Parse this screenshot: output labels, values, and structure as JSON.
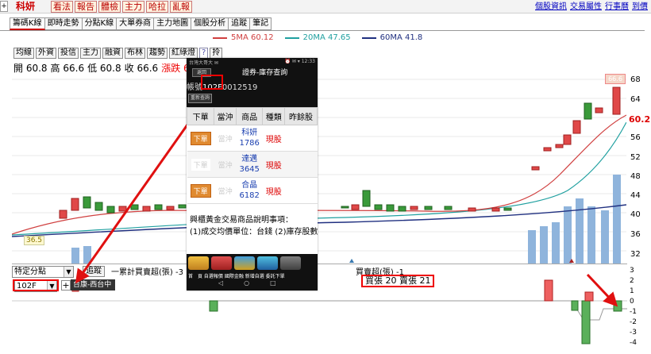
{
  "topbar": {
    "home_icon": "plus-icon",
    "stock_name": "科妍",
    "menu": [
      "看法",
      "報告",
      "體檢",
      "主力",
      "哈拉",
      "亂報"
    ],
    "links": [
      "個股資訊",
      "交易屬性",
      "行事曆",
      "到價"
    ]
  },
  "tabs": [
    "籌碼K線",
    "即時走勢",
    "分點K線",
    "大單券商",
    "主力地圖",
    "個股分析",
    "追蹤",
    "筆記"
  ],
  "legend": [
    {
      "label": "5MA 60.12",
      "color": "#d04040"
    },
    {
      "label": "20MA 47.65",
      "color": "#20a0a0"
    },
    {
      "label": "60MA 41.8",
      "color": "#203080"
    }
  ],
  "tools": [
    "均線",
    "外資",
    "投信",
    "主力",
    "融資",
    "布林",
    "趨勢",
    "紅綠燈",
    "?",
    "拎"
  ],
  "ohlc": {
    "open": "開 60.8",
    "high": "高 66.6",
    "low": "低 60.8",
    "close": "收 66.6",
    "change": "漲跌 6"
  },
  "main_axis": [
    "68",
    "64",
    "60",
    "56",
    "52",
    "48",
    "44",
    "40",
    "36",
    "32"
  ],
  "price_tag": "66.6",
  "min_tag": "36.5",
  "current_price": "60.2",
  "lower": {
    "mode_select": "特定分點",
    "track_button": "追蹤",
    "acc_label": "一累計買賣超(張) -3",
    "broker_select": "102F",
    "plus": "+",
    "broker_popup": "台康-西台中",
    "bs_label": "買賣超(張) -1",
    "bs_detail": "買張 20 賣張 21",
    "axis": [
      "3",
      "2",
      "1",
      "0",
      "-1",
      "-2",
      "-3",
      "-4"
    ]
  },
  "phone": {
    "status_left": "台灣大哥大 ✉",
    "status_right": "⏰ ✉ ▾ 12:33",
    "back": "返回",
    "title": "證券-庫存查詢",
    "account_prefix": "帳號",
    "account_branch": "102F",
    "account_no": "0012519",
    "requery": "重新查詢",
    "columns": [
      "下單",
      "當沖",
      "商品",
      "種類",
      "昨餘股"
    ],
    "rows": [
      {
        "order": "下單",
        "enabled": true,
        "daytrade": "當沖",
        "name": "科妍",
        "code": "1786",
        "kind": "現股"
      },
      {
        "order": "下單",
        "enabled": false,
        "daytrade": "當沖",
        "name": "達邁",
        "code": "3645",
        "kind": "現股"
      },
      {
        "order": "下單",
        "enabled": true,
        "daytrade": "當沖",
        "name": "合晶",
        "code": "6182",
        "kind": "現股"
      }
    ],
    "note1": "興櫃黃金交易商品說明事項：",
    "note2": "(1)成交均價單位：台錢 (2)庫存股數",
    "navlabels": "首　頁 自選報價 國際金融 新增自選 委託下單",
    "sysnav": [
      "◁",
      "○",
      "□"
    ]
  },
  "colors": {
    "up": "#e04848",
    "down": "#3a9a3a",
    "volume": "#8fb4dc"
  }
}
